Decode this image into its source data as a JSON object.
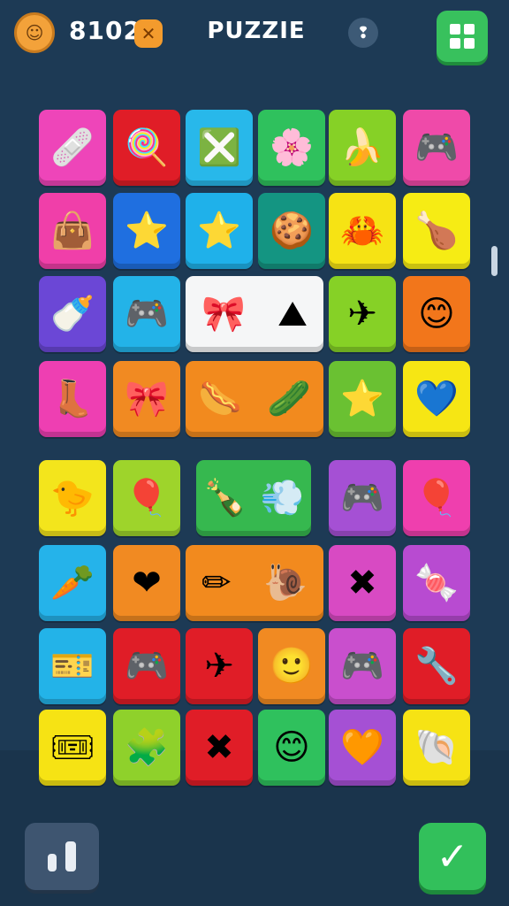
{
  "header": {
    "coin_icon": "coin-icon",
    "score": "8102",
    "boost_icon": "boost-icon",
    "title": "PUZZIE",
    "hint_icon": "hint-icon",
    "menu_icon": "grid-menu-icon"
  },
  "board": {
    "tiles": [
      {
        "color": "#ee45b9",
        "icon": "bandage-icon",
        "glyph": "🩹"
      },
      {
        "color": "#e01d27",
        "icon": "candy-icon",
        "glyph": "🍭"
      },
      {
        "color": "#28b8ea",
        "icon": "crossed-box-icon",
        "glyph": "❎"
      },
      {
        "color": "#2fc15d",
        "icon": "flower-icon",
        "glyph": "🌸"
      },
      {
        "color": "#86d126",
        "icon": "banana-icon",
        "glyph": "🍌"
      },
      {
        "color": "#ef4aa9",
        "icon": "gamepad-icon",
        "glyph": "🎮"
      },
      {
        "color": "#f03fa9",
        "icon": "bag-icon",
        "glyph": "👜"
      },
      {
        "color": "#1f6fe0",
        "icon": "star-icon",
        "glyph": "⭐"
      },
      {
        "color": "#1fb1ea",
        "icon": "star-icon",
        "glyph": "⭐"
      },
      {
        "color": "#149582",
        "icon": "cookie-icon",
        "glyph": "🍪"
      },
      {
        "color": "#f6e314",
        "icon": "creature-icon",
        "glyph": "🦀"
      },
      {
        "color": "#f6ec14",
        "icon": "drumstick-icon",
        "glyph": "🍗"
      },
      {
        "color": "#6b47d6",
        "icon": "bottle-icon",
        "glyph": "🍼"
      },
      {
        "color": "#23b3e8",
        "icon": "gamepad-icon",
        "glyph": "🎮"
      },
      {
        "color": "#86d126",
        "icon": "paper-plane-icon",
        "glyph": "✈"
      },
      {
        "color": "#f2761b",
        "icon": "smiley-icon",
        "glyph": "😊"
      },
      {
        "color": "#ee3fb2",
        "icon": "boot-icon",
        "glyph": "👢"
      },
      {
        "color": "#f18a22",
        "icon": "bowtie-icon",
        "glyph": "🎀"
      },
      {
        "color": "#6ac132",
        "icon": "star-icon",
        "glyph": "⭐"
      },
      {
        "color": "#f6e614",
        "icon": "heart-icon",
        "glyph": "💙"
      },
      {
        "color": "#f3e51c",
        "icon": "chick-icon",
        "glyph": "🐤"
      },
      {
        "color": "#9ed42b",
        "icon": "balloon-icon",
        "glyph": "🎈"
      },
      {
        "color": "#a550d4",
        "icon": "gamepad-icon",
        "glyph": "🎮"
      },
      {
        "color": "#ef3fae",
        "icon": "balloon-icon",
        "glyph": "🎈"
      },
      {
        "color": "#25b3ea",
        "icon": "carrot-icon",
        "glyph": "🥕"
      },
      {
        "color": "#f18a22",
        "icon": "heart-icon",
        "glyph": "❤"
      },
      {
        "color": "#d84ac3",
        "icon": "crossed-tools-icon",
        "glyph": "✖"
      },
      {
        "color": "#b84bd1",
        "icon": "candy-icon",
        "glyph": "🍬"
      },
      {
        "color": "#23b3e8",
        "icon": "ticket-icon",
        "glyph": "🎫"
      },
      {
        "color": "#e01d27",
        "icon": "gamepad-icon",
        "glyph": "🎮"
      },
      {
        "color": "#e01d27",
        "icon": "plane-icon",
        "glyph": "✈"
      },
      {
        "color": "#f18a22",
        "icon": "smiley-icon",
        "glyph": "🙂"
      },
      {
        "color": "#c94fcd",
        "icon": "gamepad-icon",
        "glyph": "🎮"
      },
      {
        "color": "#e01d27",
        "icon": "wrench-icon",
        "glyph": "🔧"
      },
      {
        "color": "#f6e314",
        "icon": "ticket-icon",
        "glyph": "🎟"
      },
      {
        "color": "#8fd12b",
        "icon": "blob-icon",
        "glyph": "🧩"
      },
      {
        "color": "#e01d27",
        "icon": "crossed-sticks-icon",
        "glyph": "✖"
      },
      {
        "color": "#2fc15d",
        "icon": "smiley-icon",
        "glyph": "😊"
      },
      {
        "color": "#a550d4",
        "icon": "heart-icon",
        "glyph": "🧡"
      },
      {
        "color": "#f6e314",
        "icon": "shell-icon",
        "glyph": "🐚"
      }
    ],
    "wide_tiles": [
      {
        "color": "#f5f6f7",
        "icons": [
          "bow-icon",
          "mountain-box-icon"
        ],
        "glyphs": [
          "🎀",
          "⛰"
        ]
      },
      {
        "color": "#f28a1e",
        "icons": [
          "sausage-icon",
          "bean-icon"
        ],
        "glyphs": [
          "🌭",
          "🥒"
        ]
      },
      {
        "color": "#36b84f",
        "icons": [
          "bottle-icon",
          "splash-icon"
        ],
        "glyphs": [
          "🍾",
          "💨"
        ]
      },
      {
        "color": "#f28a1e",
        "icons": [
          "pencil-icon",
          "snail-icon"
        ],
        "glyphs": [
          "✏",
          "🐌"
        ]
      }
    ]
  },
  "footer": {
    "left_icon": "pause-icon",
    "right_icon": "checkmark-icon",
    "check_glyph": "✓"
  }
}
